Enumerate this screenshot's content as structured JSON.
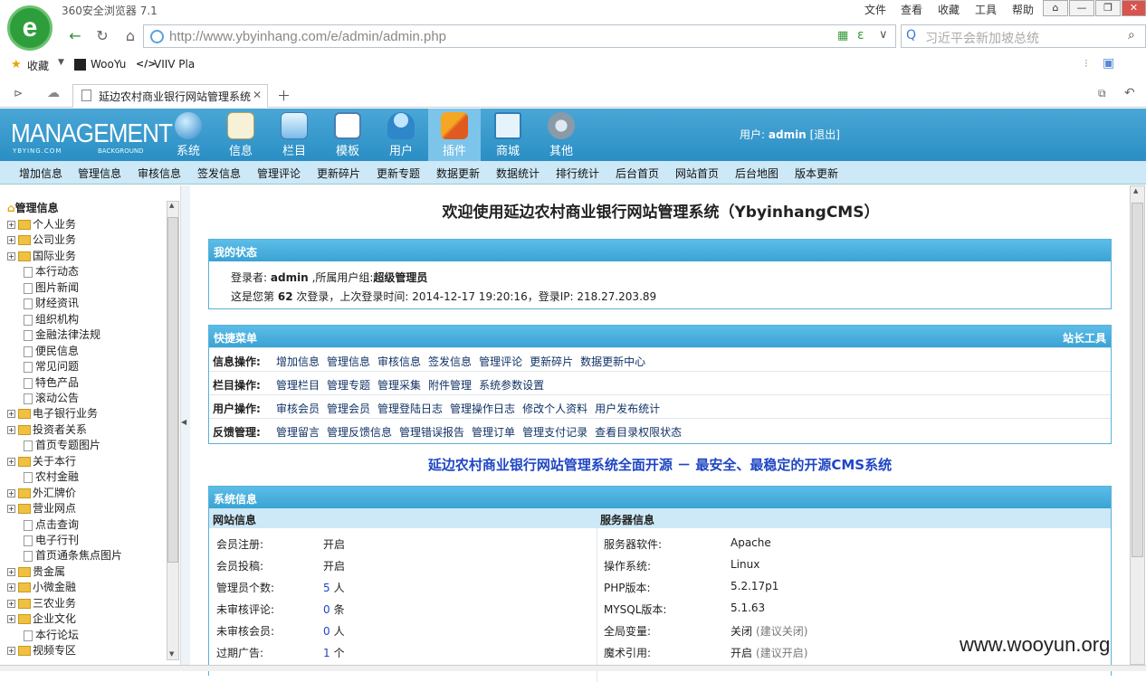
{
  "browser": {
    "title": "360安全浏览器 7.1",
    "menu": [
      "文件",
      "查看",
      "收藏",
      "工具",
      "帮助"
    ],
    "url": "http://www.ybyinhang.com/e/admin/admin.php",
    "search_placeholder": "习近平会新加坡总统",
    "bookmarks": [
      "收藏",
      "WooYu",
      "VIIV Pla"
    ],
    "tab_title": "延边农村商业银行网站管理系统"
  },
  "cms": {
    "logo": "MANAGEMENT",
    "logo_sub": "YBYING.COM",
    "logo_sub2": "BACKGROUND",
    "top_nav": [
      "系统",
      "信息",
      "栏目",
      "模板",
      "用户",
      "插件",
      "商城",
      "其他"
    ],
    "active_top": "插件",
    "user_label": "用户:",
    "user_name": "admin",
    "logout": "[退出]",
    "sub_nav": [
      "增加信息",
      "管理信息",
      "审核信息",
      "签发信息",
      "管理评论",
      "更新碎片",
      "更新专题",
      "数据更新",
      "数据统计",
      "排行统计",
      "后台首页",
      "网站首页",
      "后台地图",
      "版本更新"
    ]
  },
  "sidebar": {
    "title": "管理信息",
    "items": [
      {
        "label": "个人业务",
        "type": "folder"
      },
      {
        "label": "公司业务",
        "type": "folder"
      },
      {
        "label": "国际业务",
        "type": "folder"
      },
      {
        "label": "本行动态",
        "type": "page"
      },
      {
        "label": "图片新闻",
        "type": "page"
      },
      {
        "label": "财经资讯",
        "type": "page"
      },
      {
        "label": "组织机构",
        "type": "page"
      },
      {
        "label": "金融法律法规",
        "type": "page"
      },
      {
        "label": "便民信息",
        "type": "page"
      },
      {
        "label": "常见问题",
        "type": "page"
      },
      {
        "label": "特色产品",
        "type": "page"
      },
      {
        "label": "滚动公告",
        "type": "page"
      },
      {
        "label": "电子银行业务",
        "type": "folder"
      },
      {
        "label": "投资者关系",
        "type": "folder"
      },
      {
        "label": "首页专题图片",
        "type": "page"
      },
      {
        "label": "关于本行",
        "type": "folder"
      },
      {
        "label": "农村金融",
        "type": "page"
      },
      {
        "label": "外汇牌价",
        "type": "folder"
      },
      {
        "label": "营业网点",
        "type": "folder"
      },
      {
        "label": "点击查询",
        "type": "page"
      },
      {
        "label": "电子行刊",
        "type": "page"
      },
      {
        "label": "首页通条焦点图片",
        "type": "page"
      },
      {
        "label": "贵金属",
        "type": "folder"
      },
      {
        "label": "小微金融",
        "type": "folder"
      },
      {
        "label": "三农业务",
        "type": "folder"
      },
      {
        "label": "企业文化",
        "type": "folder"
      },
      {
        "label": "本行论坛",
        "type": "page"
      },
      {
        "label": "视频专区",
        "type": "folder"
      }
    ]
  },
  "main": {
    "title": "欢迎使用延边农村商业银行网站管理系统（YbyinhangCMS）",
    "status": {
      "header": "我的状态",
      "login_label": "登录者:",
      "login_user": "admin",
      "group_label": ",所属用户组:",
      "group": "超级管理员",
      "count_prefix": "这是您第",
      "count": "62",
      "count_suffix": "次登录，上次登录时间:",
      "last_time": "2014-12-17 19:20:16",
      "ip_label": "，登录IP:",
      "ip": "218.27.203.89"
    },
    "quick": {
      "header": "快捷菜单",
      "tools": "站长工具",
      "rows": [
        {
          "label": "信息操作:",
          "links": [
            "增加信息",
            "管理信息",
            "审核信息",
            "签发信息",
            "管理评论",
            "更新碎片",
            "数据更新中心"
          ]
        },
        {
          "label": "栏目操作:",
          "links": [
            "管理栏目",
            "管理专题",
            "管理采集",
            "附件管理",
            "系统参数设置"
          ]
        },
        {
          "label": "用户操作:",
          "links": [
            "审核会员",
            "管理会员",
            "管理登陆日志",
            "管理操作日志",
            "修改个人资料",
            "用户发布统计"
          ]
        },
        {
          "label": "反馈管理:",
          "links": [
            "管理留言",
            "管理反馈信息",
            "管理错误报告",
            "管理订单",
            "管理支付记录",
            "查看目录权限状态"
          ]
        }
      ]
    },
    "slogan": "延边农村商业银行网站管理系统全面开源 － 最安全、最稳定的开源CMS系统",
    "sysinfo": {
      "header": "系统信息",
      "site_header": "网站信息",
      "server_header": "服务器信息",
      "site": [
        {
          "k": "会员注册:",
          "v": "开启"
        },
        {
          "k": "会员投稿:",
          "v": "开启"
        },
        {
          "k": "管理员个数:",
          "n": "5",
          "u": "人"
        },
        {
          "k": "未审核评论:",
          "n": "0",
          "u": "条"
        },
        {
          "k": "未审核会员:",
          "n": "0",
          "u": "人"
        },
        {
          "k": "过期广告:",
          "n": "1",
          "u": "个"
        }
      ],
      "server": [
        {
          "k": "服务器软件:",
          "v": "Apache"
        },
        {
          "k": "操作系统:",
          "v": "Linux"
        },
        {
          "k": "PHP版本:",
          "v": "5.2.17p1"
        },
        {
          "k": "MYSQL版本:",
          "v": "5.1.63"
        },
        {
          "k": "全局变量:",
          "v": "关闭",
          "note": "(建议关闭)"
        },
        {
          "k": "魔术引用:",
          "v": "开启",
          "note": "(建议开启)"
        }
      ]
    }
  },
  "watermark": "www.wooyun.org"
}
